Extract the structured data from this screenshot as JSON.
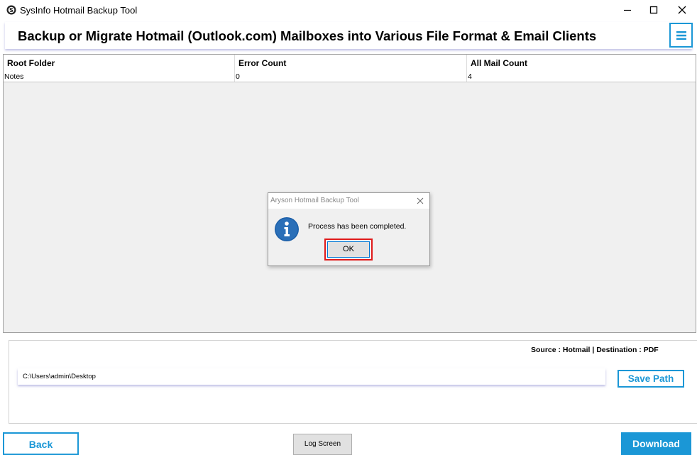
{
  "window": {
    "title": "SysInfo Hotmail Backup Tool",
    "icons": {
      "app": "sysinfo-logo-icon",
      "minimize": "minimize-icon",
      "maximize": "maximize-icon",
      "close": "close-icon"
    }
  },
  "header": {
    "title": "Backup or Migrate Hotmail (Outlook.com) Mailboxes into Various File Format & Email Clients",
    "menu_icon": "hamburger-menu-icon",
    "accent_color": "#1b97d6"
  },
  "grid": {
    "columns": [
      "Root Folder",
      "Error Count",
      "All Mail Count"
    ],
    "rows": [
      {
        "root_folder": "Notes",
        "error_count": "0",
        "all_mail_count": "4"
      }
    ]
  },
  "dialog": {
    "title": "Aryson Hotmail Backup Tool",
    "message": "Process has been completed.",
    "ok_label": "OK",
    "icon": "information-icon",
    "highlight_color": "#e01a1a"
  },
  "bottom": {
    "source_destination": "Source : Hotmail | Destination : PDF",
    "path_value": "C:\\Users\\admin\\Desktop",
    "save_path_label": "Save Path"
  },
  "footer": {
    "back_label": "Back",
    "log_label": "Log Screen",
    "download_label": "Download"
  }
}
